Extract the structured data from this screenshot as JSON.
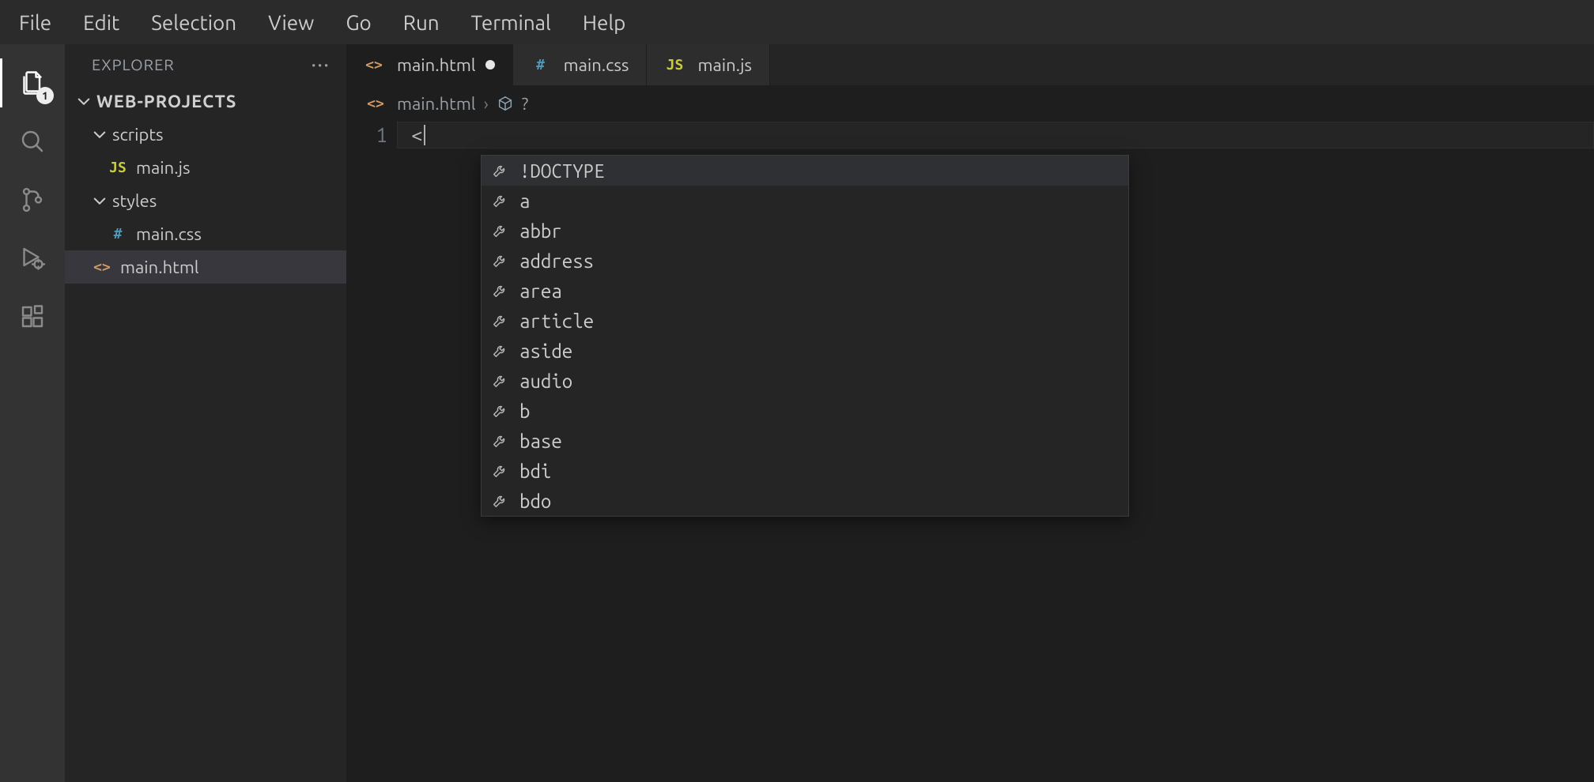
{
  "menu": [
    "File",
    "Edit",
    "Selection",
    "View",
    "Go",
    "Run",
    "Terminal",
    "Help"
  ],
  "activity": {
    "explorer_badge": "1"
  },
  "sidebar": {
    "title": "EXPLORER",
    "project": "WEB-PROJECTS",
    "tree": [
      {
        "kind": "folder",
        "name": "scripts",
        "depth": 1,
        "expanded": true
      },
      {
        "kind": "file",
        "name": "main.js",
        "depth": 2,
        "icon": "js"
      },
      {
        "kind": "folder",
        "name": "styles",
        "depth": 1,
        "expanded": true
      },
      {
        "kind": "file",
        "name": "main.css",
        "depth": 2,
        "icon": "css"
      },
      {
        "kind": "file",
        "name": "main.html",
        "depth": 1,
        "icon": "html",
        "selected": true
      }
    ]
  },
  "tabs": [
    {
      "name": "main.html",
      "icon": "html",
      "active": true,
      "dirty": true
    },
    {
      "name": "main.css",
      "icon": "css",
      "active": false
    },
    {
      "name": "main.js",
      "icon": "js",
      "active": false
    }
  ],
  "breadcrumb": {
    "file": "main.html",
    "symbol": "?"
  },
  "editor": {
    "line_no": "1",
    "text": "<"
  },
  "suggest": [
    "!DOCTYPE",
    "a",
    "abbr",
    "address",
    "area",
    "article",
    "aside",
    "audio",
    "b",
    "base",
    "bdi",
    "bdo"
  ]
}
